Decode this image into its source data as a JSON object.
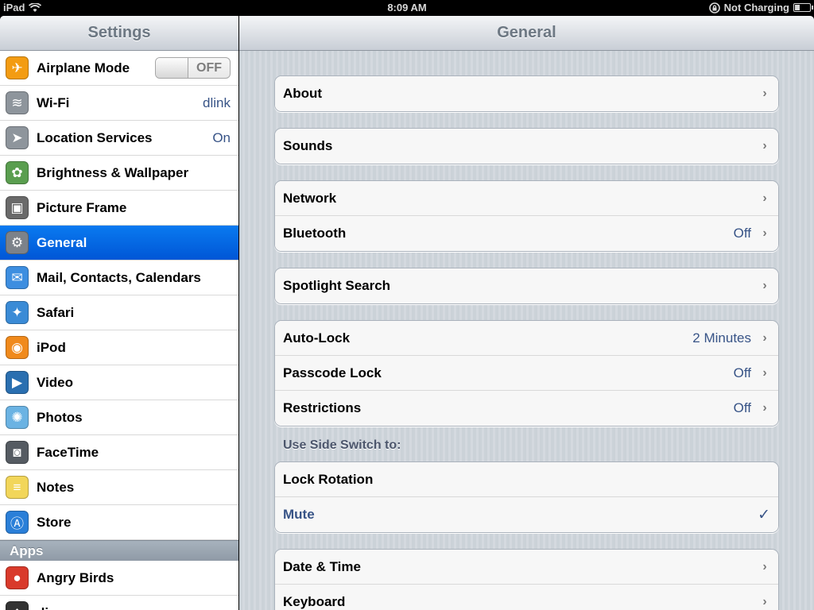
{
  "status_bar": {
    "device": "iPad",
    "time": "8:09 AM",
    "charging": "Not Charging"
  },
  "master": {
    "title": "Settings",
    "items": [
      {
        "label": "Airplane Mode",
        "icon": "airplane-icon",
        "color": "#f39c12",
        "toggle": "OFF"
      },
      {
        "label": "Wi-Fi",
        "icon": "wifi-icon",
        "color": "#8e959c",
        "value": "dlink"
      },
      {
        "label": "Location Services",
        "icon": "location-arrow-icon",
        "color": "#8e959c",
        "value": "On"
      },
      {
        "label": "Brightness & Wallpaper",
        "icon": "brightness-wallpaper-icon",
        "color": "#5a9e4f"
      },
      {
        "label": "Picture Frame",
        "icon": "picture-frame-icon",
        "color": "#6a6a6a"
      },
      {
        "label": "General",
        "icon": "gear-icon",
        "color": "#7c828a",
        "selected": true
      },
      {
        "label": "Mail, Contacts, Calendars",
        "icon": "mail-icon",
        "color": "#3d8ee0"
      },
      {
        "label": "Safari",
        "icon": "compass-icon",
        "color": "#3a8bd6"
      },
      {
        "label": "iPod",
        "icon": "ipod-icon",
        "color": "#f08a1c"
      },
      {
        "label": "Video",
        "icon": "clapperboard-icon",
        "color": "#2a6fb0"
      },
      {
        "label": "Photos",
        "icon": "sunflower-icon",
        "color": "#6bb3e3"
      },
      {
        "label": "FaceTime",
        "icon": "camera-icon",
        "color": "#555b62"
      },
      {
        "label": "Notes",
        "icon": "notepad-icon",
        "color": "#f2d65a"
      },
      {
        "label": "Store",
        "icon": "app-store-icon",
        "color": "#2a7fd8"
      }
    ],
    "apps_header": "Apps",
    "apps": [
      {
        "label": "Angry Birds",
        "icon": "angry-bird-icon",
        "color": "#d93a2b"
      },
      {
        "label": "diav",
        "icon": "app-icon",
        "color": "#333333"
      }
    ]
  },
  "detail": {
    "title": "General",
    "groups": [
      [
        {
          "label": "About"
        }
      ],
      [
        {
          "label": "Sounds"
        }
      ],
      [
        {
          "label": "Network"
        },
        {
          "label": "Bluetooth",
          "value": "Off"
        }
      ],
      [
        {
          "label": "Spotlight Search"
        }
      ],
      [
        {
          "label": "Auto-Lock",
          "value": "2 Minutes"
        },
        {
          "label": "Passcode Lock",
          "value": "Off"
        },
        {
          "label": "Restrictions",
          "value": "Off"
        }
      ],
      [
        {
          "label": "Lock Rotation"
        },
        {
          "label": "Mute",
          "checked": true
        }
      ],
      [
        {
          "label": "Date & Time"
        },
        {
          "label": "Keyboard"
        }
      ]
    ],
    "side_switch_title": "Use Side Switch to:"
  }
}
